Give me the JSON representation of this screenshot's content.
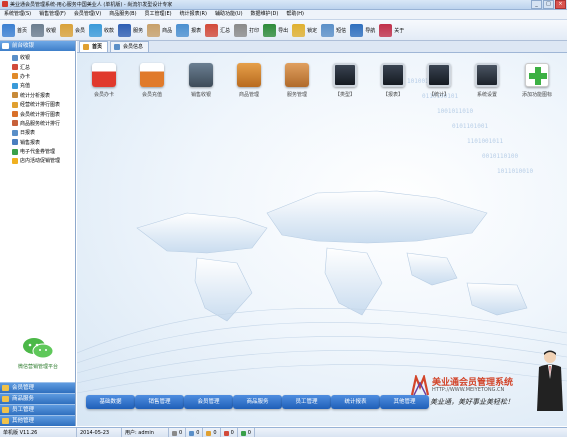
{
  "window": {
    "title": "美业通会员管理系统-用心服务中国美业人 (单机版) - 尚流尔发型设计专家",
    "minimize": "_",
    "maximize": "□",
    "close": "×"
  },
  "menu": [
    "系统管理(S)",
    "销售管理(F)",
    "会员管理(V)",
    "商品服务(B)",
    "员工管理(E)",
    "统计报表(R)",
    "辅助功能(U)",
    "数据维护(D)",
    "帮助(H)"
  ],
  "toolbar": [
    {
      "label": "首页",
      "icon": "monitor-icon",
      "color": "#3b7fd1"
    },
    {
      "label": "收银",
      "icon": "cash-register-icon",
      "color": "#6b7d8f"
    },
    {
      "label": "会员",
      "icon": "member-card-icon",
      "color": "#d9a23a"
    },
    {
      "label": "收款",
      "icon": "payment-icon",
      "color": "#3a9ad9"
    },
    {
      "label": "服务",
      "icon": "book-icon",
      "color": "#2f5fb3"
    },
    {
      "label": "商品",
      "icon": "box-icon",
      "color": "#c7a06a"
    },
    {
      "label": "报表",
      "icon": "report-icon",
      "color": "#4a8fd0"
    },
    {
      "label": "汇总",
      "icon": "chart-icon",
      "color": "#d24a3a"
    },
    {
      "label": "打印",
      "icon": "printer-icon",
      "color": "#8a8a8a"
    },
    {
      "label": "导出",
      "icon": "excel-icon",
      "color": "#2e8b3a"
    },
    {
      "label": "锁定",
      "icon": "lock-icon",
      "color": "#e0b030"
    },
    {
      "label": "短信",
      "icon": "sms-icon",
      "color": "#5a8fc8"
    },
    {
      "label": "导航",
      "icon": "navigation-icon",
      "color": "#2f6fbe"
    },
    {
      "label": "关于",
      "icon": "about-icon",
      "color": "#c0304a"
    }
  ],
  "left_panel": {
    "header": "前台收银",
    "items": [
      {
        "label": "收银",
        "icon": "cash-icon",
        "color": "#5a8fc8"
      },
      {
        "label": "汇总",
        "icon": "summary-icon",
        "color": "#d24a3a"
      },
      {
        "label": "办卡",
        "icon": "card-icon",
        "color": "#e08a2a"
      },
      {
        "label": "充值",
        "icon": "recharge-icon",
        "color": "#3a9ad9"
      },
      {
        "label": "统计分析报表",
        "icon": "report-icon",
        "color": "#c78a3a"
      },
      {
        "label": "经营统计排行图表",
        "icon": "chart-icon",
        "color": "#e0a030"
      },
      {
        "label": "会员统计排行图表",
        "icon": "chart-icon",
        "color": "#d9702a"
      },
      {
        "label": "商品服务统计排行",
        "icon": "chart-icon",
        "color": "#c7603a"
      },
      {
        "label": "日报表",
        "icon": "daily-report-icon",
        "color": "#5a8fc8"
      },
      {
        "label": "销售报表",
        "icon": "sales-report-icon",
        "color": "#4a7fc0"
      },
      {
        "label": "电子代金券管理",
        "icon": "voucher-icon",
        "color": "#3aa04a"
      },
      {
        "label": "店内活动促销管理",
        "icon": "star-icon",
        "color": "#f0b020"
      }
    ],
    "wechat_label": "微信营销管理平台",
    "categories": [
      "会员管理",
      "商品服务",
      "员工管理",
      "其他管理"
    ]
  },
  "tabs": [
    {
      "label": "首页",
      "active": true
    },
    {
      "label": "会员信息",
      "active": false
    }
  ],
  "shortcuts": [
    {
      "label": "会员办卡",
      "icon": "calendar-card-icon"
    },
    {
      "label": "会员充值",
      "icon": "calendar-recharge-icon"
    },
    {
      "label": "销售收银",
      "icon": "cash-register-icon"
    },
    {
      "label": "商品管理",
      "icon": "product-icon"
    },
    {
      "label": "服务管理",
      "icon": "service-icon"
    },
    {
      "label": "【类型】",
      "icon": "display-icon"
    },
    {
      "label": "【报表】",
      "icon": "display-icon"
    },
    {
      "label": "【统计】",
      "icon": "display-icon"
    },
    {
      "label": "系统设置",
      "icon": "settings-display-icon"
    },
    {
      "label": "添加功能图标",
      "icon": "add-icon"
    }
  ],
  "bottom_buttons": [
    "基础数据",
    "销售管理",
    "会员管理",
    "商品服务",
    "员工管理",
    "统计报表",
    "其他管理"
  ],
  "brand": {
    "name": "美业通会员管理系统",
    "url": "HTTP://WWW.MEIYETONG.CN",
    "slogan": "美业通，美好事业美轻松！"
  },
  "status": {
    "version": "单机版 V11.26",
    "date": "2014-05-23",
    "user": "用户: admin",
    "counts": [
      "0",
      "0",
      "0",
      "0",
      "0"
    ]
  }
}
